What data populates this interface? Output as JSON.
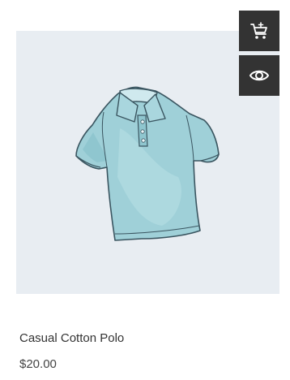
{
  "product": {
    "title": "Casual Cotton Polo",
    "price": "$20.00",
    "image_subject": "light-blue-polo-shirt",
    "colors": {
      "image_background": "#e8edf2",
      "shirt": "#9fd0d8",
      "button_background": "#333333",
      "button_icon": "#ffffff"
    }
  },
  "actions": {
    "add_to_cart_icon": "cart-plus-icon",
    "quick_view_icon": "eye-icon"
  }
}
